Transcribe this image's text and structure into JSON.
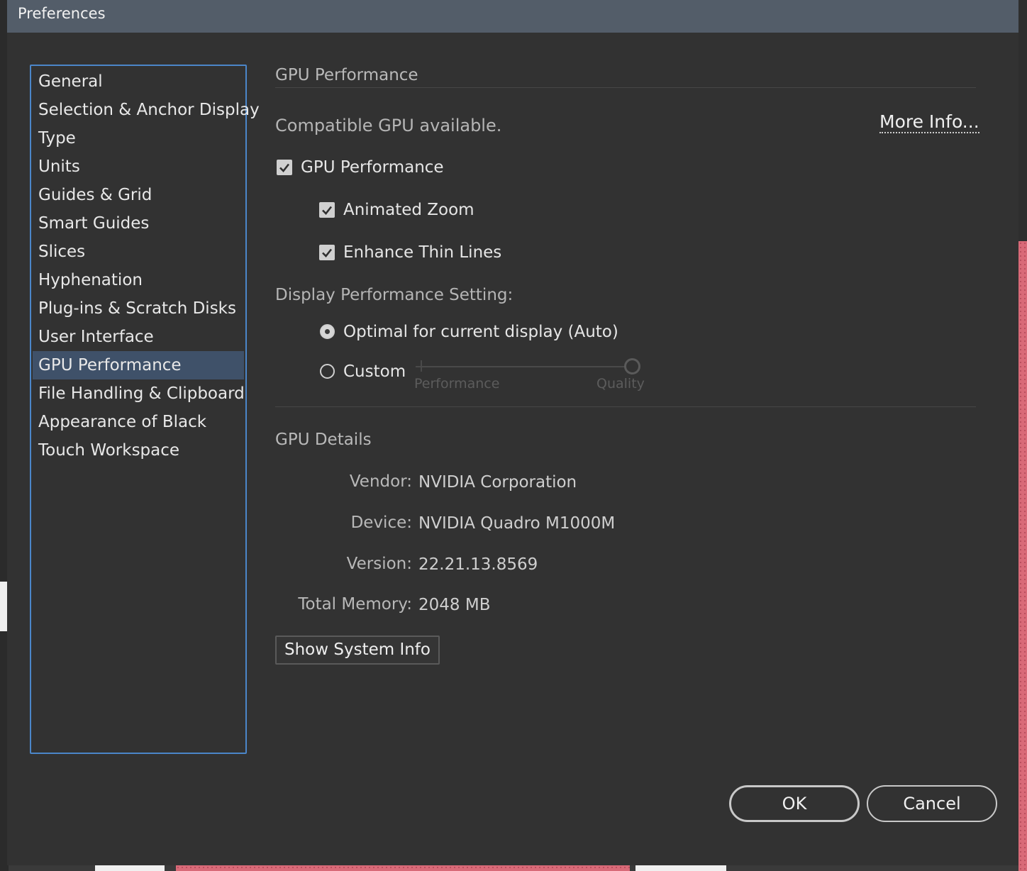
{
  "dialog": {
    "title": "Preferences"
  },
  "sidebar": {
    "items": [
      {
        "label": "General"
      },
      {
        "label": "Selection & Anchor Display"
      },
      {
        "label": "Type"
      },
      {
        "label": "Units"
      },
      {
        "label": "Guides & Grid"
      },
      {
        "label": "Smart Guides"
      },
      {
        "label": "Slices"
      },
      {
        "label": "Hyphenation"
      },
      {
        "label": "Plug-ins & Scratch Disks"
      },
      {
        "label": "User Interface"
      },
      {
        "label": "GPU Performance"
      },
      {
        "label": "File Handling & Clipboard"
      },
      {
        "label": "Appearance of Black"
      },
      {
        "label": "Touch Workspace"
      }
    ],
    "selected": "GPU Performance"
  },
  "gpu": {
    "section_title": "GPU Performance",
    "status": "Compatible GPU available.",
    "more_info": "More Info...",
    "gpu_performance": {
      "label": "GPU Performance",
      "checked": true
    },
    "animated_zoom": {
      "label": "Animated Zoom",
      "checked": true
    },
    "enhance_thin_lines": {
      "label": "Enhance Thin Lines",
      "checked": true
    },
    "display_setting_label": "Display Performance Setting:",
    "option_auto": {
      "label": "Optimal for current display (Auto)",
      "selected": true
    },
    "option_custom": {
      "label": "Custom",
      "selected": false
    },
    "slider": {
      "min_label": "Performance",
      "max_label": "Quality",
      "value": 1.0,
      "enabled": false
    }
  },
  "details": {
    "section_title": "GPU Details",
    "vendor_label": "Vendor:",
    "vendor_value": "NVIDIA Corporation",
    "device_label": "Device:",
    "device_value": "NVIDIA Quadro M1000M",
    "version_label": "Version:",
    "version_value": "22.21.13.8569",
    "memory_label": "Total Memory:",
    "memory_value": "2048 MB",
    "show_system_info": "Show System Info"
  },
  "buttons": {
    "ok": "OK",
    "cancel": "Cancel"
  },
  "colors": {
    "titlebar": "#535d69",
    "selection": "#3f5169",
    "focus_border": "#4b86c9",
    "background": "#323232"
  }
}
